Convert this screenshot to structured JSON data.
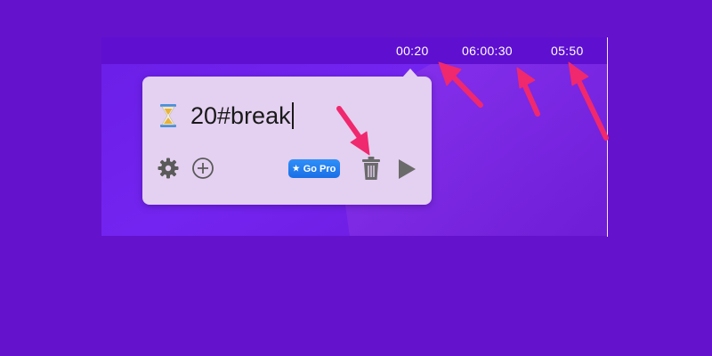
{
  "menubar": {
    "timers": [
      "00:20",
      "06:00:30",
      "05:50"
    ]
  },
  "popover": {
    "task_text": "20#break",
    "go_pro_label": "Go Pro",
    "icons": {
      "task": "hourglass-icon",
      "settings": "gear-icon",
      "add": "plus-circle-icon",
      "delete": "trash-icon",
      "start": "play-icon"
    }
  },
  "colors": {
    "background": "#6412cc",
    "popover": "#e4d0f0",
    "go_pro": "#2f8ff8",
    "annotation_arrow": "#f0286e"
  }
}
